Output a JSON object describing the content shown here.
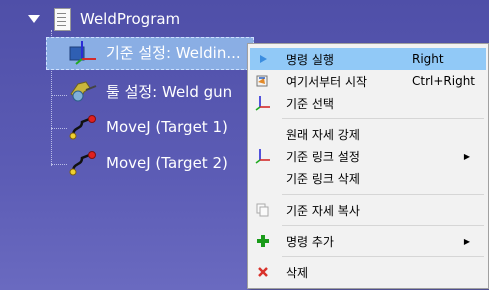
{
  "tree": {
    "root_label": "WeldProgram",
    "children": [
      {
        "label": "기준 설정: Weldin...",
        "icon": "frame-icon"
      },
      {
        "label": "툴 설정: Weld gun",
        "icon": "tool-icon"
      },
      {
        "label": "MoveJ (Target 1)",
        "icon": "movej-icon"
      },
      {
        "label": "MoveJ (Target 2)",
        "icon": "movej-icon"
      }
    ]
  },
  "context_menu": {
    "items": [
      {
        "label": "명령 실행",
        "shortcut": "Right",
        "icon": "play-icon"
      },
      {
        "label": "여기서부터 시작",
        "shortcut": "Ctrl+Right",
        "icon": "start-here-icon"
      },
      {
        "label": "기준 선택",
        "icon": "axes-icon"
      },
      {
        "label": "원래 자세 강제"
      },
      {
        "label": "기준 링크 설정",
        "icon": "axes-icon"
      },
      {
        "label": "기준 링크 삭제"
      },
      {
        "label": "기준 자세 복사",
        "icon": "copy-icon"
      },
      {
        "label": "명령 추가",
        "icon": "plus-icon"
      },
      {
        "label": "삭제",
        "icon": "delete-icon"
      }
    ]
  },
  "colors": {
    "background": "#5656ae",
    "selection": "#8aaee4",
    "menu_highlight": "#91c9f7",
    "plus": "#1a9b1a",
    "delete": "#d9322b"
  }
}
